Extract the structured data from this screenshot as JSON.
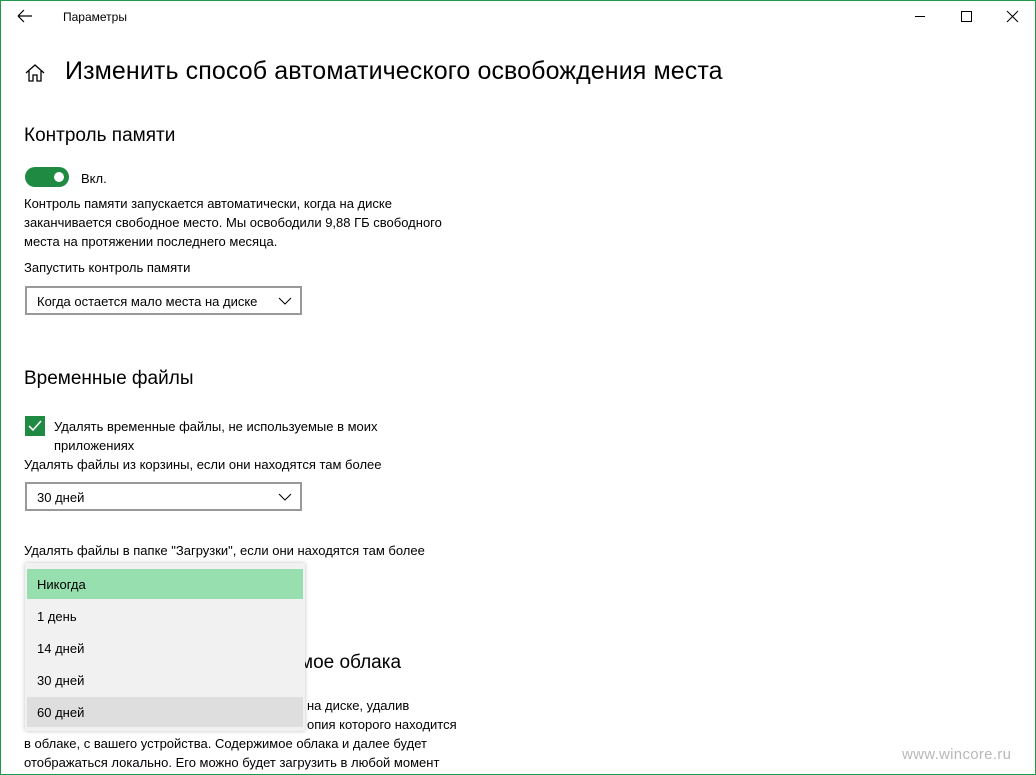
{
  "window": {
    "title": "Параметры"
  },
  "page": {
    "title": "Изменить способ автоматического освобождения места"
  },
  "storage_sense": {
    "heading": "Контроль памяти",
    "toggle_label": "Вкл.",
    "toggle_on": true,
    "description_lines": [
      "Контроль памяти запускается автоматически, когда на диске",
      "заканчивается свободное место. Мы освободили 9,88 ГБ свободного",
      "места на протяжении последнего месяца."
    ],
    "run_label": "Запустить контроль памяти",
    "run_value": "Когда остается мало места на диске"
  },
  "temp_files": {
    "heading": "Временные файлы",
    "checkbox_checked": true,
    "checkbox_label_lines": [
      "Удалять временные файлы, не используемые в моих",
      "приложениях"
    ],
    "recycle_label": "Удалять файлы из корзины, если они находятся там более",
    "recycle_value": "30 дней",
    "downloads_label": "Удалять файлы в папке \"Загрузки\", если они находятся там более",
    "downloads_options": [
      "Никогда",
      "1 день",
      "14 дней",
      "30 дней",
      "60 дней"
    ],
    "downloads_selected": "Никогда"
  },
  "cloud": {
    "heading_partial": "мое облака",
    "text_lines": [
      "на диске, удалив",
      "опия которого находится",
      "в облаке, с вашего устройства. Содержимое облака и далее будет",
      "отображаться локально. Его можно будет загрузить в любой момент"
    ]
  },
  "watermark": "www.wincore.ru",
  "colors": {
    "accent": "#1e8a42",
    "selected_item": "#98dfaf",
    "window_border": "#1f9a48"
  }
}
